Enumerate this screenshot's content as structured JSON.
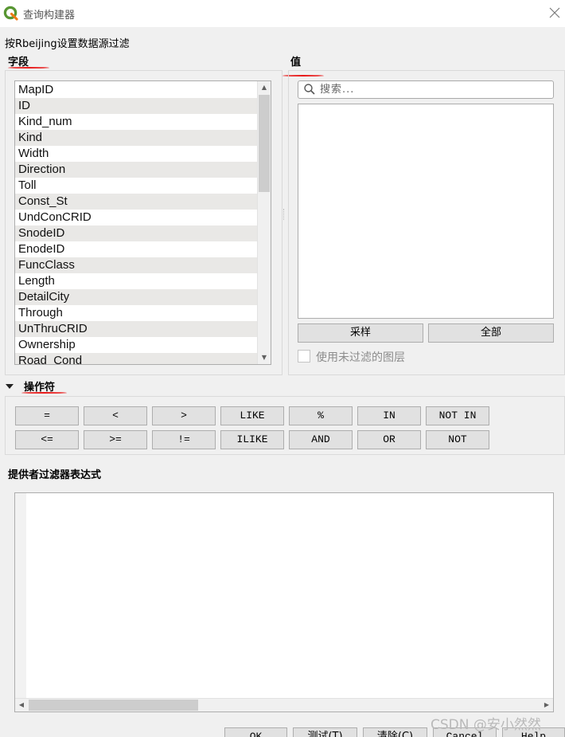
{
  "window": {
    "title": "查询构建器",
    "subtitle": "按Rbeijing设置数据源过滤"
  },
  "fields": {
    "label": "字段",
    "items": [
      "MapID",
      "ID",
      "Kind_num",
      "Kind",
      "Width",
      "Direction",
      "Toll",
      "Const_St",
      "UndConCRID",
      "SnodeID",
      "EnodeID",
      "FuncClass",
      "Length",
      "DetailCity",
      "Through",
      "UnThruCRID",
      "Ownership",
      "Road_Cond"
    ]
  },
  "values": {
    "label": "值",
    "search_placeholder": "搜索...",
    "sample_button": "采样",
    "all_button": "全部",
    "use_unfiltered_label": "使用未过滤的图层",
    "use_unfiltered_checked": false
  },
  "operators": {
    "label": "操作符",
    "row1": [
      "=",
      "<",
      ">",
      "LIKE",
      "%",
      "IN",
      "NOT IN"
    ],
    "row2": [
      "<=",
      ">=",
      "!=",
      "ILIKE",
      "AND",
      "OR",
      "NOT"
    ]
  },
  "expression": {
    "label": "提供者过滤器表达式",
    "value": ""
  },
  "buttons": {
    "ok": "OK",
    "test": "测试(T)",
    "clear": "清除(C)",
    "cancel": "Cancel",
    "help": "Help"
  },
  "watermark": "CSDN @安小然然",
  "colors": {
    "annotation_red": "#e81a1a",
    "qgis_green": "#589632"
  }
}
